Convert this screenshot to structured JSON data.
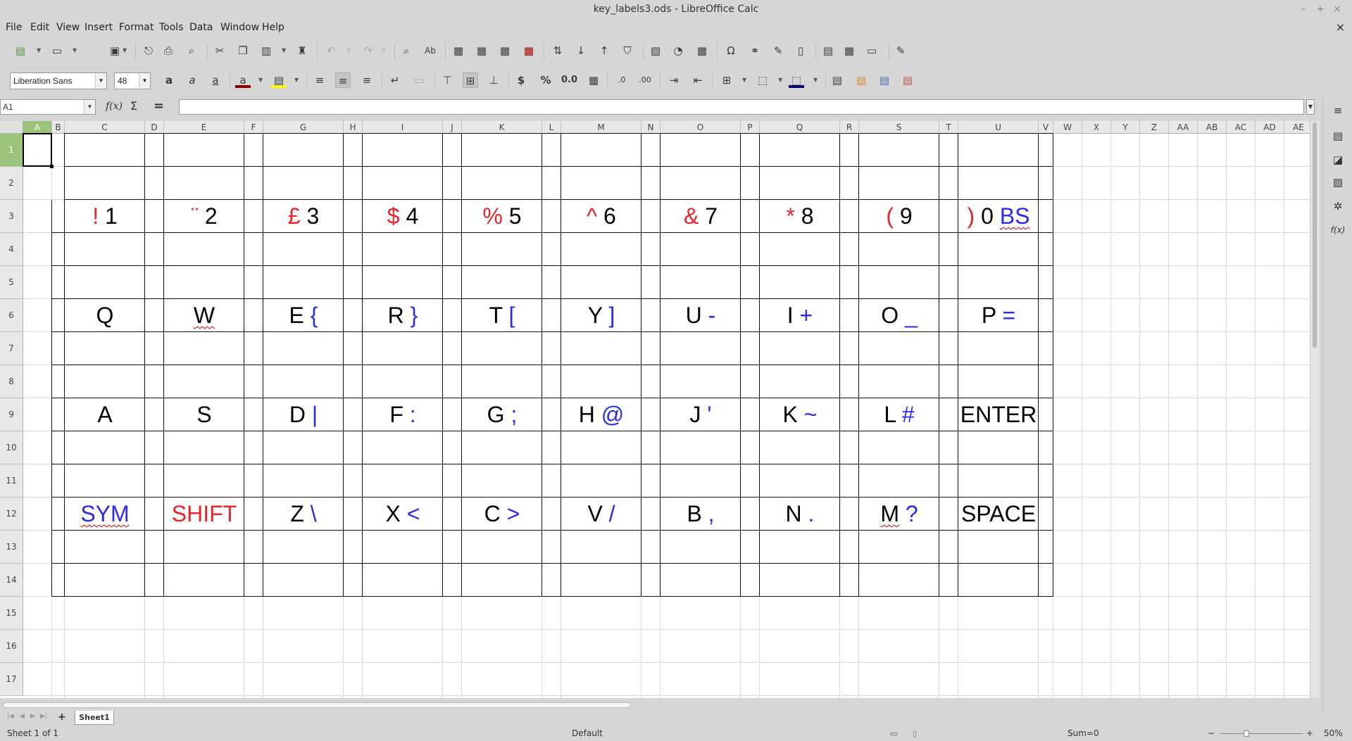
{
  "window": {
    "title": "key_labels3.ods - LibreOffice Calc",
    "min": "–",
    "max": "+",
    "close": "×",
    "doc_close": "×"
  },
  "menu": [
    "File",
    "Edit",
    "View",
    "Insert",
    "Format",
    "Tools",
    "Data",
    "Window",
    "Help"
  ],
  "font": {
    "name": "Liberation Sans",
    "size": "48"
  },
  "namebox": "A1",
  "formula": "",
  "formula_fx": "f(x)",
  "formula_sigma": "Σ",
  "formula_eq": "=",
  "columns": [
    "A",
    "B",
    "C",
    "D",
    "E",
    "F",
    "G",
    "H",
    "I",
    "J",
    "K",
    "L",
    "M",
    "N",
    "O",
    "P",
    "Q",
    "R",
    "S",
    "T",
    "U",
    "V",
    "W",
    "X",
    "Y",
    "Z",
    "AA",
    "AB",
    "AC",
    "AD",
    "AE"
  ],
  "rows": [
    "1",
    "2",
    "3",
    "4",
    "5",
    "6",
    "7",
    "8",
    "9",
    "10",
    "11",
    "12",
    "13",
    "14",
    "15",
    "16",
    "17"
  ],
  "colors": {
    "red": "#e8242a",
    "blue": "#2a2ae8",
    "selection": "#9cc37a"
  },
  "keys": [
    [
      [
        {
          "t": "!",
          "c": "red"
        },
        {
          "t": " 1",
          "c": "blk"
        }
      ],
      [
        {
          "t": "¨",
          "c": "red"
        },
        {
          "t": " 2",
          "c": "blk"
        }
      ],
      [
        {
          "t": "£",
          "c": "red"
        },
        {
          "t": " 3",
          "c": "blk"
        }
      ],
      [
        {
          "t": "$",
          "c": "red"
        },
        {
          "t": " 4",
          "c": "blk"
        }
      ],
      [
        {
          "t": "%",
          "c": "red"
        },
        {
          "t": " 5",
          "c": "blk"
        }
      ],
      [
        {
          "t": "^",
          "c": "red"
        },
        {
          "t": " 6",
          "c": "blk"
        }
      ],
      [
        {
          "t": "&",
          "c": "red"
        },
        {
          "t": " 7",
          "c": "blk"
        }
      ],
      [
        {
          "t": "*",
          "c": "red"
        },
        {
          "t": " 8",
          "c": "blk"
        }
      ],
      [
        {
          "t": "(",
          "c": "red"
        },
        {
          "t": " 9",
          "c": "blk"
        }
      ],
      [
        {
          "t": ")",
          "c": "red"
        },
        {
          "t": " 0 ",
          "c": "blk"
        },
        {
          "t": "BS",
          "c": "blue",
          "sq": true
        }
      ]
    ],
    [
      [
        {
          "t": "Q",
          "c": "blk"
        }
      ],
      [
        {
          "t": "W",
          "c": "blk",
          "sq": true
        }
      ],
      [
        {
          "t": "E ",
          "c": "blk"
        },
        {
          "t": "{",
          "c": "blue"
        }
      ],
      [
        {
          "t": "R ",
          "c": "blk"
        },
        {
          "t": "}",
          "c": "blue"
        }
      ],
      [
        {
          "t": "T ",
          "c": "blk"
        },
        {
          "t": "[",
          "c": "blue"
        }
      ],
      [
        {
          "t": "Y ",
          "c": "blk"
        },
        {
          "t": "]",
          "c": "blue"
        }
      ],
      [
        {
          "t": "U ",
          "c": "blk"
        },
        {
          "t": "-",
          "c": "blue"
        }
      ],
      [
        {
          "t": "I ",
          "c": "blk"
        },
        {
          "t": "+",
          "c": "blue"
        }
      ],
      [
        {
          "t": "O ",
          "c": "blk"
        },
        {
          "t": "_",
          "c": "blue"
        }
      ],
      [
        {
          "t": "P ",
          "c": "blk"
        },
        {
          "t": "=",
          "c": "blue"
        }
      ]
    ],
    [
      [
        {
          "t": "A",
          "c": "blk"
        }
      ],
      [
        {
          "t": "S",
          "c": "blk"
        }
      ],
      [
        {
          "t": "D ",
          "c": "blk"
        },
        {
          "t": "|",
          "c": "blue"
        }
      ],
      [
        {
          "t": "F ",
          "c": "blk"
        },
        {
          "t": ":",
          "c": "blue"
        }
      ],
      [
        {
          "t": "G ",
          "c": "blk"
        },
        {
          "t": ";",
          "c": "blue"
        }
      ],
      [
        {
          "t": "H ",
          "c": "blk"
        },
        {
          "t": "@",
          "c": "blue"
        }
      ],
      [
        {
          "t": "J ",
          "c": "blk"
        },
        {
          "t": "'",
          "c": "blue"
        }
      ],
      [
        {
          "t": "K ",
          "c": "blk"
        },
        {
          "t": "~",
          "c": "blue"
        }
      ],
      [
        {
          "t": "L ",
          "c": "blk"
        },
        {
          "t": "#",
          "c": "blue"
        }
      ],
      [
        {
          "t": "ENTER",
          "c": "blk"
        }
      ]
    ],
    [
      [
        {
          "t": "SYM",
          "c": "blue",
          "sq": true
        }
      ],
      [
        {
          "t": "SHIFT",
          "c": "red"
        }
      ],
      [
        {
          "t": "Z ",
          "c": "blk"
        },
        {
          "t": "\\",
          "c": "blue"
        }
      ],
      [
        {
          "t": "X ",
          "c": "blk"
        },
        {
          "t": "<",
          "c": "blue"
        }
      ],
      [
        {
          "t": "C ",
          "c": "blk"
        },
        {
          "t": ">",
          "c": "blue"
        }
      ],
      [
        {
          "t": "V ",
          "c": "blk"
        },
        {
          "t": "/",
          "c": "blue"
        }
      ],
      [
        {
          "t": "B ",
          "c": "blk"
        },
        {
          "t": ",",
          "c": "blue"
        }
      ],
      [
        {
          "t": "N ",
          "c": "blk"
        },
        {
          "t": ".",
          "c": "blue"
        }
      ],
      [
        {
          "t": "M",
          "c": "blk",
          "sq": true
        },
        {
          "t": " ?",
          "c": "blue"
        }
      ],
      [
        {
          "t": "SPACE",
          "c": "blk"
        }
      ]
    ]
  ],
  "sheet_tab": "Sheet1",
  "add_sheet": "+",
  "status": {
    "sheet": "Sheet 1 of 1",
    "style": "Default",
    "sum": "Sum=0",
    "zoom": "50%",
    "zoom_minus": "−",
    "zoom_plus": "+"
  }
}
